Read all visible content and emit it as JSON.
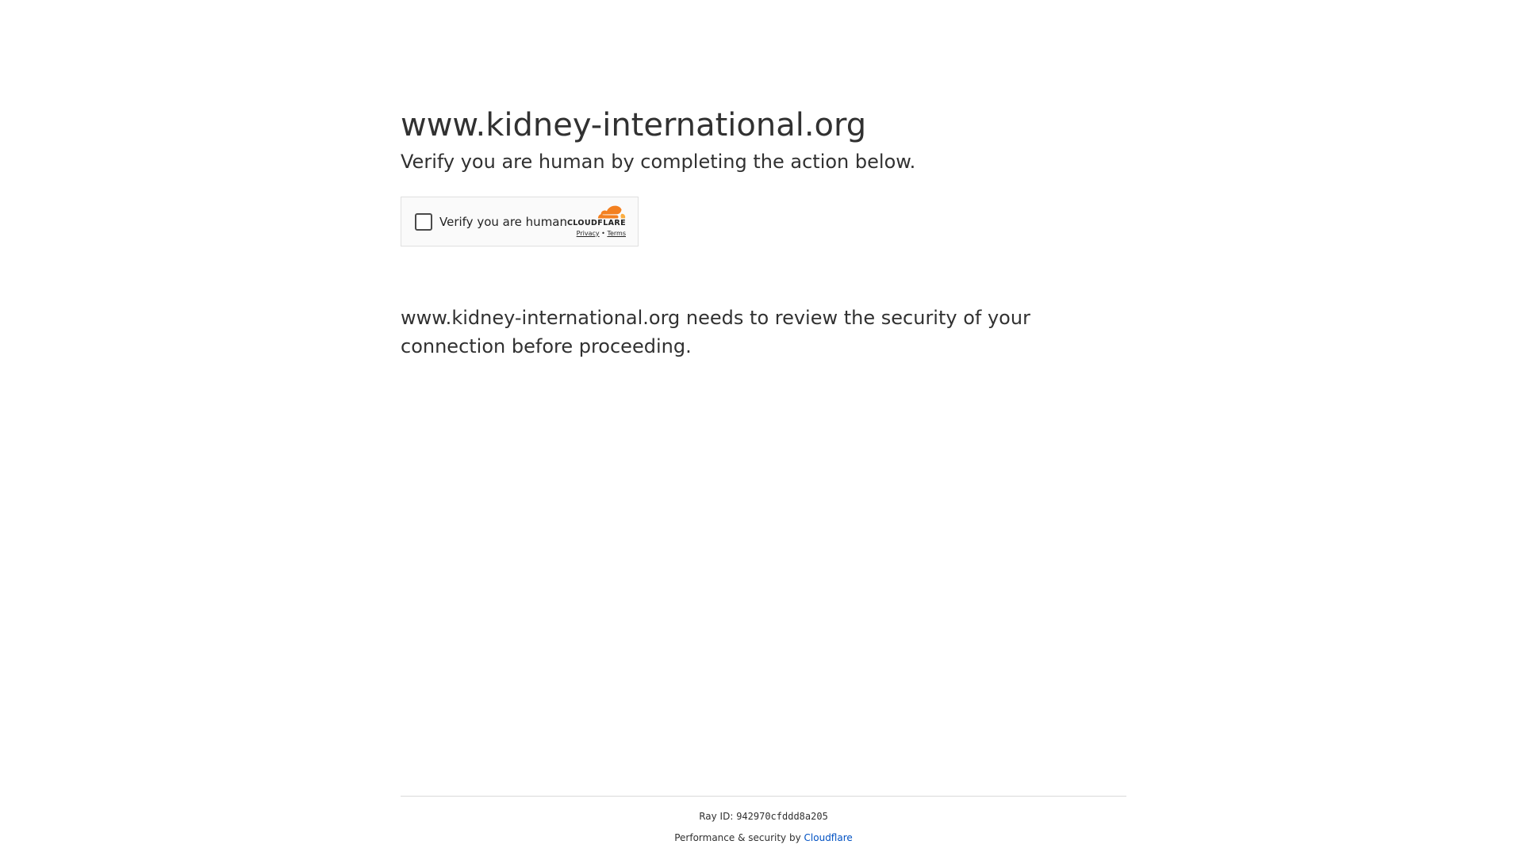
{
  "header": {
    "site_title": "www.kidney-international.org",
    "subtitle": "Verify you are human by completing the action below."
  },
  "widget": {
    "checkbox_label": "Verify you are human",
    "brand_wordmark": "CLOUDFLARE",
    "privacy_link": "Privacy",
    "link_separator": "•",
    "terms_link": "Terms",
    "brand_color": "#f38020"
  },
  "main": {
    "review_text": "www.kidney-international.org needs to review the security of your connection before proceeding."
  },
  "footer": {
    "ray_label": "Ray ID:",
    "ray_id": "942970cfddd8a205",
    "performance_text": "Performance & security by",
    "cloudflare_link": "Cloudflare",
    "link_color": "#0051c3"
  }
}
